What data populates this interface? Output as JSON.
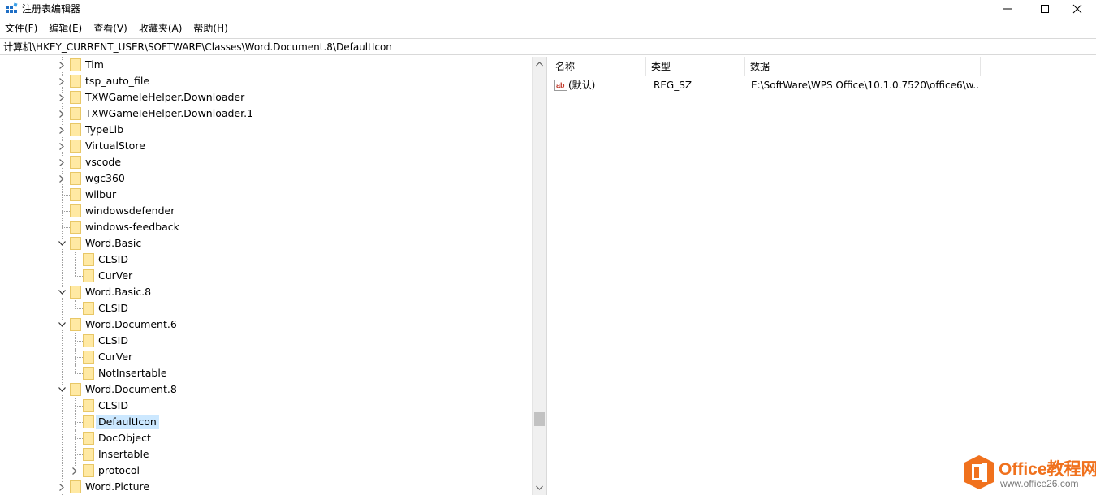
{
  "window": {
    "title": "注册表编辑器"
  },
  "menu": [
    {
      "label": "文件(F)"
    },
    {
      "label": "编辑(E)"
    },
    {
      "label": "查看(V)"
    },
    {
      "label": "收藏夹(A)"
    },
    {
      "label": "帮助(H)"
    }
  ],
  "address": {
    "path": "计算机\\HKEY_CURRENT_USER\\SOFTWARE\\Classes\\Word.Document.8\\DefaultIcon"
  },
  "tree": {
    "items": [
      {
        "label": "Tim",
        "level": 0,
        "expander": "collapsed"
      },
      {
        "label": "tsp_auto_file",
        "level": 0,
        "expander": "collapsed"
      },
      {
        "label": "TXWGameIeHelper.Downloader",
        "level": 0,
        "expander": "collapsed"
      },
      {
        "label": "TXWGameIeHelper.Downloader.1",
        "level": 0,
        "expander": "collapsed"
      },
      {
        "label": "TypeLib",
        "level": 0,
        "expander": "collapsed"
      },
      {
        "label": "VirtualStore",
        "level": 0,
        "expander": "collapsed"
      },
      {
        "label": "vscode",
        "level": 0,
        "expander": "collapsed"
      },
      {
        "label": "wgc360",
        "level": 0,
        "expander": "collapsed"
      },
      {
        "label": "wilbur",
        "level": 0,
        "expander": "none"
      },
      {
        "label": "windowsdefender",
        "level": 0,
        "expander": "none"
      },
      {
        "label": "windows-feedback",
        "level": 0,
        "expander": "none"
      },
      {
        "label": "Word.Basic",
        "level": 0,
        "expander": "expanded"
      },
      {
        "label": "CLSID",
        "level": 1,
        "expander": "none"
      },
      {
        "label": "CurVer",
        "level": 1,
        "expander": "none"
      },
      {
        "label": "Word.Basic.8",
        "level": 0,
        "expander": "expanded"
      },
      {
        "label": "CLSID",
        "level": 1,
        "expander": "none"
      },
      {
        "label": "Word.Document.6",
        "level": 0,
        "expander": "expanded"
      },
      {
        "label": "CLSID",
        "level": 1,
        "expander": "none"
      },
      {
        "label": "CurVer",
        "level": 1,
        "expander": "none"
      },
      {
        "label": "NotInsertable",
        "level": 1,
        "expander": "none"
      },
      {
        "label": "Word.Document.8",
        "level": 0,
        "expander": "expanded"
      },
      {
        "label": "CLSID",
        "level": 1,
        "expander": "none"
      },
      {
        "label": "DefaultIcon",
        "level": 1,
        "expander": "none",
        "selected": true
      },
      {
        "label": "DocObject",
        "level": 1,
        "expander": "none"
      },
      {
        "label": "Insertable",
        "level": 1,
        "expander": "none"
      },
      {
        "label": "protocol",
        "level": 1,
        "expander": "collapsed"
      },
      {
        "label": "Word.Picture",
        "level": 0,
        "expander": "collapsed"
      }
    ]
  },
  "list": {
    "columns": [
      {
        "label": "名称"
      },
      {
        "label": "类型"
      },
      {
        "label": "数据"
      }
    ],
    "rows": [
      {
        "name": "(默认)",
        "type": "REG_SZ",
        "data": "E:\\SoftWare\\WPS Office\\10.1.0.7520\\office6\\w...",
        "icon": "string-value-icon"
      }
    ]
  },
  "scrollbar": {
    "position": 0.86
  },
  "watermark": {
    "title": "Office教程网",
    "url": "www.office26.com"
  },
  "colors": {
    "selection": "#cce8ff",
    "folder": "#ffe9a3",
    "folder_stroke": "#e8c766",
    "watermark_orange": "#f0711d"
  }
}
